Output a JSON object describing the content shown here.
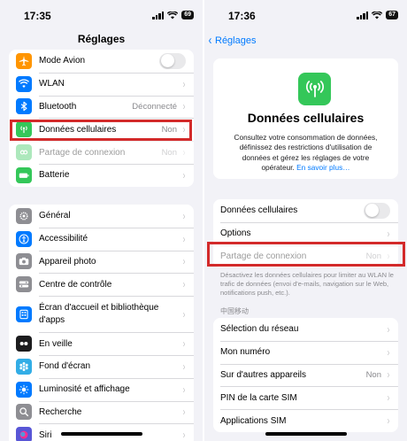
{
  "left": {
    "time": "17:35",
    "battery": "69",
    "title": "Réglages",
    "group1": [
      {
        "label": "Mode Avion",
        "value": "",
        "icon": "airplane-icon",
        "color": "#ff9500",
        "toggle": true,
        "dim": false
      },
      {
        "label": "WLAN",
        "value": "",
        "icon": "wifi-icon",
        "color": "#007aff",
        "toggle": false,
        "dim": false
      },
      {
        "label": "Bluetooth",
        "value": "Déconnecté",
        "icon": "bluetooth-icon",
        "color": "#007aff",
        "toggle": false,
        "dim": false
      },
      {
        "label": "Données cellulaires",
        "value": "Non",
        "icon": "antenna-icon",
        "color": "#34c759",
        "toggle": false,
        "dim": false
      },
      {
        "label": "Partage de connexion",
        "value": "Non",
        "icon": "hotspot-icon",
        "color": "#34c759",
        "toggle": false,
        "dim": true
      },
      {
        "label": "Batterie",
        "value": "",
        "icon": "battery-icon",
        "color": "#34c759",
        "toggle": false,
        "dim": false
      }
    ],
    "group2": [
      {
        "label": "Général",
        "icon": "gear-icon",
        "color": "#8e8e93"
      },
      {
        "label": "Accessibilité",
        "icon": "accessibility-icon",
        "color": "#007aff"
      },
      {
        "label": "Appareil photo",
        "icon": "camera-icon",
        "color": "#8e8e93"
      },
      {
        "label": "Centre de contrôle",
        "icon": "control-center-icon",
        "color": "#8e8e93"
      },
      {
        "label": "Écran d'accueil et bibliothèque d'apps",
        "icon": "home-screen-icon",
        "color": "#007aff",
        "twoLine": true
      },
      {
        "label": "En veille",
        "icon": "standby-icon",
        "color": "#1c1c1e"
      },
      {
        "label": "Fond d'écran",
        "icon": "wallpaper-icon",
        "color": "#32ade6"
      },
      {
        "label": "Luminosité et affichage",
        "icon": "brightness-icon",
        "color": "#007aff"
      },
      {
        "label": "Recherche",
        "icon": "search-icon",
        "color": "#8e8e93"
      },
      {
        "label": "Siri",
        "icon": "siri-icon",
        "color": "#5856d6"
      }
    ]
  },
  "right": {
    "time": "17:36",
    "battery": "67",
    "back_label": "Réglages",
    "hero_title": "Données cellulaires",
    "hero_desc": "Consultez votre consommation de données, définissez des restrictions d'utilisation de données et gérez les réglages de votre opérateur.",
    "hero_link": "En savoir plus…",
    "group1": [
      {
        "label": "Données cellulaires",
        "value": "",
        "toggle": true,
        "dim": false
      },
      {
        "label": "Options",
        "value": "",
        "toggle": false,
        "dim": false
      },
      {
        "label": "Partage de connexion",
        "value": "Non",
        "toggle": false,
        "dim": true
      }
    ],
    "note": "Désactivez les données cellulaires pour limiter au WLAN le trafic de données (envoi d'e-mails, navigation sur le Web, notifications push, etc.).",
    "section_header": "中国移动",
    "group2": [
      {
        "label": "Sélection du réseau",
        "value": ""
      },
      {
        "label": "Mon numéro",
        "value": ""
      },
      {
        "label": "Sur d'autres appareils",
        "value": "Non"
      },
      {
        "label": "PIN de la carte SIM",
        "value": ""
      },
      {
        "label": "Applications SIM",
        "value": ""
      }
    ]
  },
  "colors": {
    "highlight": "#d32a2a",
    "accent": "#007aff",
    "green": "#34c759"
  }
}
